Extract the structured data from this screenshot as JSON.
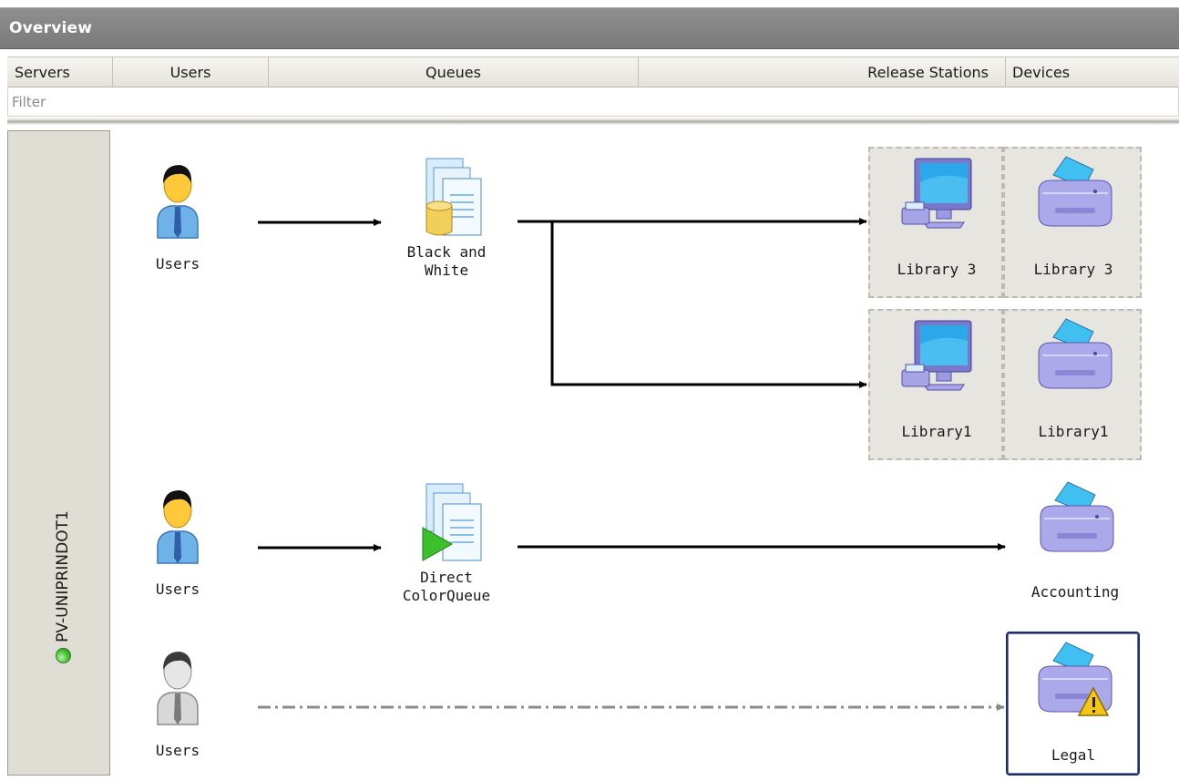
{
  "window": {
    "title": "Overview"
  },
  "columns": [
    "Servers",
    "Users",
    "Queues",
    "Release Stations",
    "Devices"
  ],
  "filter": {
    "placeholder": "Filter"
  },
  "server": {
    "name": "PV-UNIPRINDOT1",
    "status_color": "#3fbf2e"
  },
  "rows": [
    {
      "user": {
        "label": "Users",
        "icon": "user-icon"
      },
      "queue": {
        "label": "Black and White",
        "line1": "Black and",
        "line2": "White",
        "icon": "queue-db-icon"
      },
      "stations": [
        {
          "station": "Library 3",
          "device": "Library 3"
        },
        {
          "station": "Library1",
          "device": "Library1"
        }
      ]
    },
    {
      "user": {
        "label": "Users",
        "icon": "user-icon"
      },
      "queue": {
        "label": "Direct ColorQueue",
        "line1": "Direct",
        "line2": "ColorQueue",
        "icon": "queue-direct-icon"
      },
      "device": {
        "label": "Accounting",
        "icon": "printer-icon"
      }
    },
    {
      "user": {
        "label": "Users",
        "icon": "user-disabled-icon"
      },
      "device": {
        "label": "Legal",
        "icon": "printer-warning-icon",
        "selected": true
      }
    }
  ],
  "colors": {
    "titlebar": "#858585",
    "link": "#000000",
    "link_inactive": "#8a8a8a",
    "selection": "#1f2f66"
  }
}
